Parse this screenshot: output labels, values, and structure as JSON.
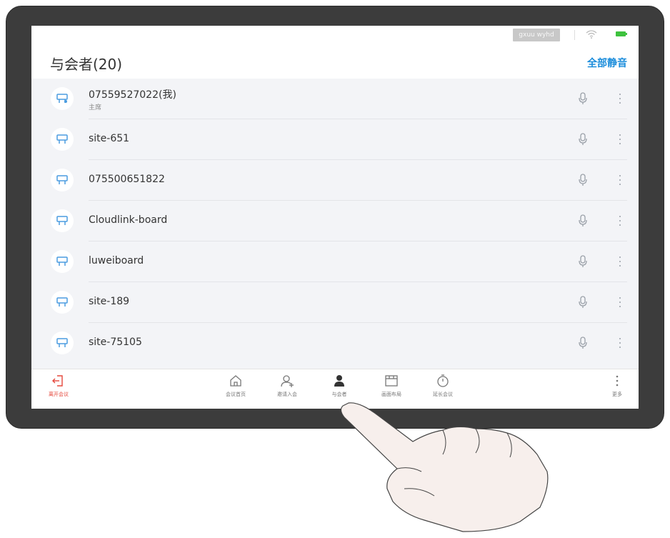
{
  "status_bar": {
    "network_label": "gxuu wyhd"
  },
  "header": {
    "title": "与会者(20)",
    "mute_all": "全部静音"
  },
  "participants": [
    {
      "name": "07559527022(我)",
      "role": "主席",
      "avatar_icon": "terminal-icon",
      "mic_icon": "microphone-icon"
    },
    {
      "name": "site-651",
      "avatar_icon": "terminal-icon",
      "mic_icon": "microphone-icon"
    },
    {
      "name": "075500651822",
      "avatar_icon": "terminal-icon",
      "mic_icon": "microphone-icon"
    },
    {
      "name": "Cloudlink-board",
      "avatar_icon": "terminal-icon",
      "mic_icon": "microphone-icon"
    },
    {
      "name": "luweiboard",
      "avatar_icon": "terminal-icon",
      "mic_icon": "microphone-icon"
    },
    {
      "name": "site-189",
      "avatar_icon": "terminal-icon",
      "mic_icon": "microphone-icon"
    },
    {
      "name": "site-75105",
      "avatar_icon": "terminal-icon",
      "mic_icon": "microphone-icon"
    }
  ],
  "toolbar": {
    "leave": "离开会议",
    "home": "会议首页",
    "invite": "邀请入会",
    "participants": "与会者",
    "layout": "画面布局",
    "extend": "延长会议",
    "more": "更多"
  },
  "colors": {
    "accent": "#1a8cdb",
    "leave": "#e5483c",
    "list_bg": "#f3f4f7",
    "battery": "#3ec23e"
  }
}
